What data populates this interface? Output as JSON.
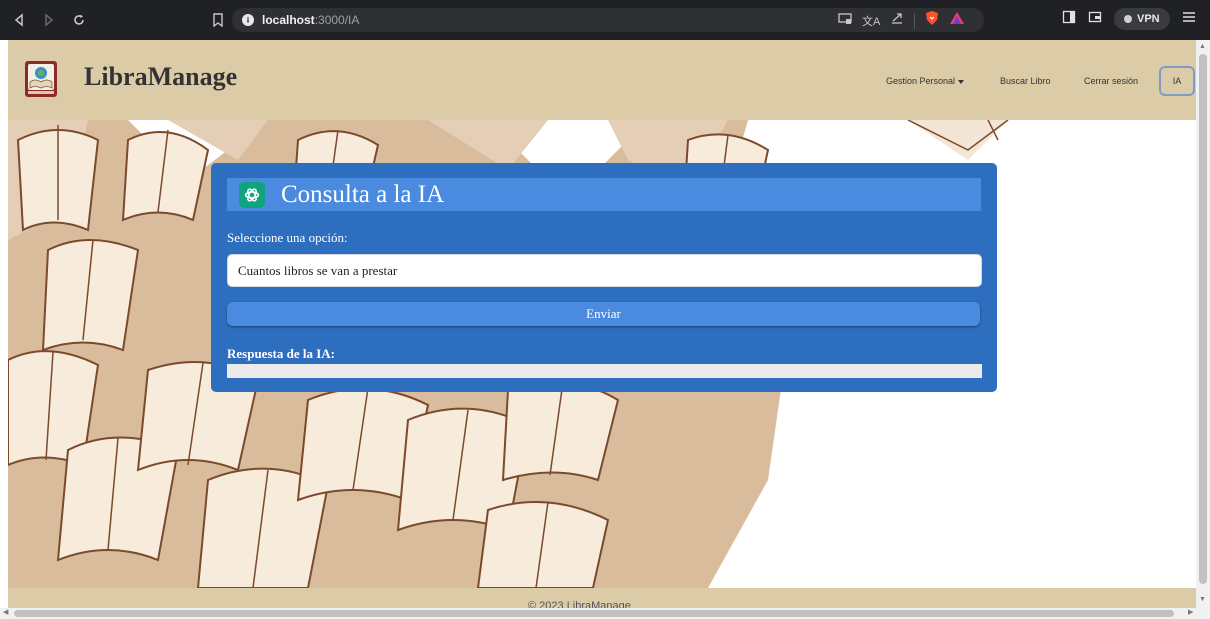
{
  "browser": {
    "url_host": "localhost",
    "url_path": ":3000/IA",
    "vpn_label": "VPN"
  },
  "header": {
    "brand": "LibraManage",
    "nav": {
      "gestion": "Gestion Personal",
      "buscar": "Buscar Libro",
      "cerrar": "Cerrar sesión",
      "ia": "IA"
    }
  },
  "card": {
    "title": "Consulta a la IA",
    "select_label": "Seleccione una opción:",
    "select_value": "Cuantos libros se van a prestar",
    "send_label": "Enviar",
    "response_label": "Respuesta de la IA:",
    "response_text": ""
  },
  "footer": {
    "text": "© 2023 LibraManage"
  },
  "colors": {
    "header_bg": "#dccba7",
    "card_bg": "#2d6ebf",
    "accent": "#4a8be0",
    "openai": "#10a37f"
  }
}
